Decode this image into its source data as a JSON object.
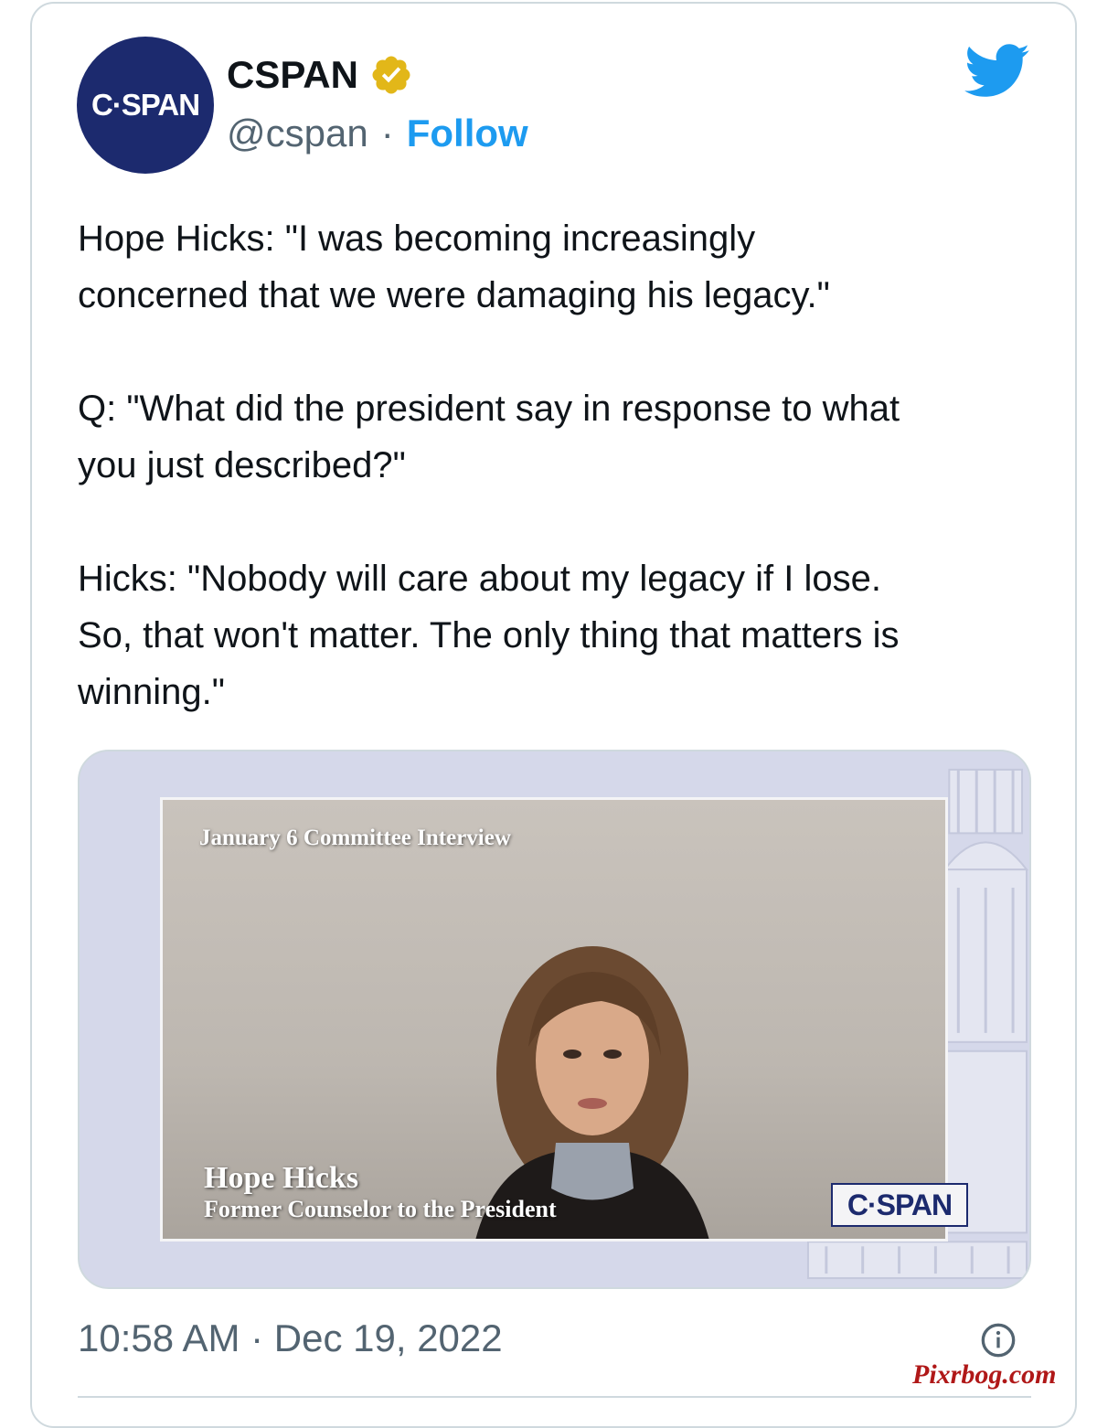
{
  "author": {
    "display_name": "CSPAN",
    "handle": "@cspan",
    "separator": "·",
    "follow_label": "Follow",
    "avatar_text": "C·SPAN",
    "verified": true
  },
  "icons": {
    "verified": "verified-badge-icon",
    "platform": "twitter-bird-icon",
    "info": "info-icon"
  },
  "tweet": {
    "paragraphs": [
      "Hope Hicks: \"I was becoming increasingly\nconcerned that we were damaging his legacy.\"",
      "Q: \"What did the president say in response to what\nyou just described?\"",
      "Hicks: \"Nobody will care about my legacy if I lose.\nSo, that won't matter. The only thing that matters is\nwinning.\""
    ]
  },
  "media": {
    "caption_top": "January 6 Committee Interview",
    "lower_third_name": "Hope Hicks",
    "lower_third_title": "Former Counselor to the President",
    "network_bug": "C·SPAN"
  },
  "footer": {
    "timestamp": "10:58 AM · Dec 19, 2022",
    "watermark": "Pixrbog.com"
  },
  "colors": {
    "accent": "#1d9bf0",
    "cspan_navy": "#1c2a6e",
    "verified_gold": "#e2b719",
    "text_primary": "#0f1419",
    "text_secondary": "#536471"
  }
}
